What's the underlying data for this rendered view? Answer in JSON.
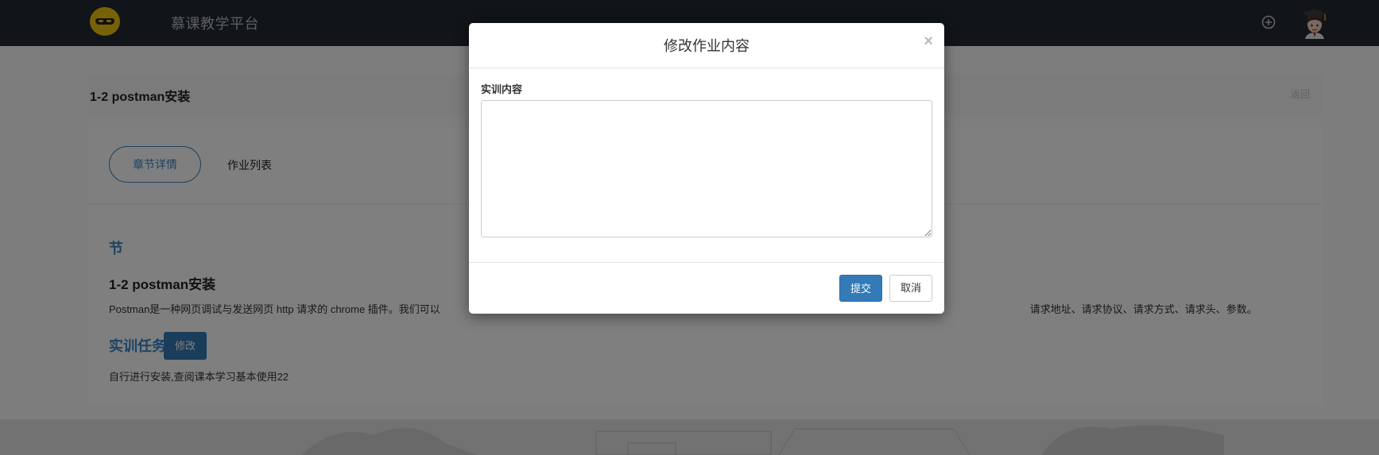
{
  "navbar": {
    "title": "慕课教学平台",
    "logo_icon": "ninja-mask-logo",
    "add_icon": "plus-circle-icon",
    "avatar_icon": "graduate-avatar"
  },
  "header": {
    "title": "1-2 postman安装",
    "back_label": "返回"
  },
  "tabs": [
    {
      "label": "章节详情",
      "active": true
    },
    {
      "label": "作业列表",
      "active": false
    }
  ],
  "section": {
    "label": "节",
    "lesson_title": "1-2 postman安装",
    "description_start": "Postman是一种网页调试与发送网页 http 请求的 chrome 插件。我们可以",
    "description_end": "请求地址、请求协议、请求方式、请求头、参数。",
    "task_label": "实训任务",
    "edit_label": "修改",
    "task_text": "自行进行安装,查阅课本学习基本使用22"
  },
  "modal": {
    "title": "修改作业内容",
    "close_label": "×",
    "field_label": "实训内容",
    "field_value": "",
    "submit_label": "提交",
    "cancel_label": "取消"
  },
  "colors": {
    "navbar_bg": "#222831",
    "accent": "#337ab7",
    "link_blue": "#3a87c8",
    "logo_yellow": "#f1c40f"
  }
}
